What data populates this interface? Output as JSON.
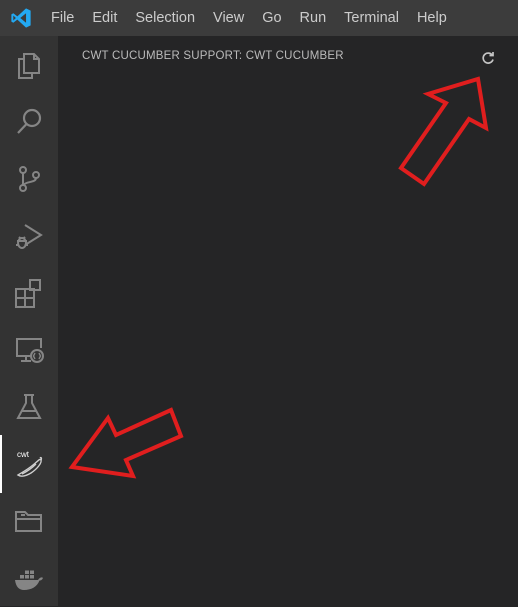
{
  "menubar": {
    "items": [
      "File",
      "Edit",
      "Selection",
      "View",
      "Go",
      "Run",
      "Terminal",
      "Help"
    ]
  },
  "activitybar": {
    "items": [
      {
        "name": "explorer",
        "icon": "files-icon"
      },
      {
        "name": "search",
        "icon": "search-icon"
      },
      {
        "name": "source-control",
        "icon": "source-control-icon"
      },
      {
        "name": "run-debug",
        "icon": "run-debug-icon"
      },
      {
        "name": "extensions",
        "icon": "extensions-icon"
      },
      {
        "name": "remote-explorer",
        "icon": "remote-explorer-icon"
      },
      {
        "name": "testing",
        "icon": "flask-icon"
      },
      {
        "name": "cwt-cucumber",
        "icon": "cucumber-icon",
        "label": "cwt",
        "active": true
      },
      {
        "name": "folder",
        "icon": "folder-icon"
      },
      {
        "name": "docker",
        "icon": "docker-icon"
      }
    ]
  },
  "sidebar": {
    "title": "CWT CUCUMBER SUPPORT: CWT CUCUMBER",
    "refresh_icon": "refresh-icon"
  },
  "colors": {
    "menubar_bg": "#3c3c3c",
    "activitybar_bg": "#333333",
    "sidebar_bg": "#252526",
    "icon": "#858585",
    "active_indicator": "#ffffff",
    "annotation_arrow": "#e01e1e",
    "vscode_logo": "#23a9f2"
  }
}
